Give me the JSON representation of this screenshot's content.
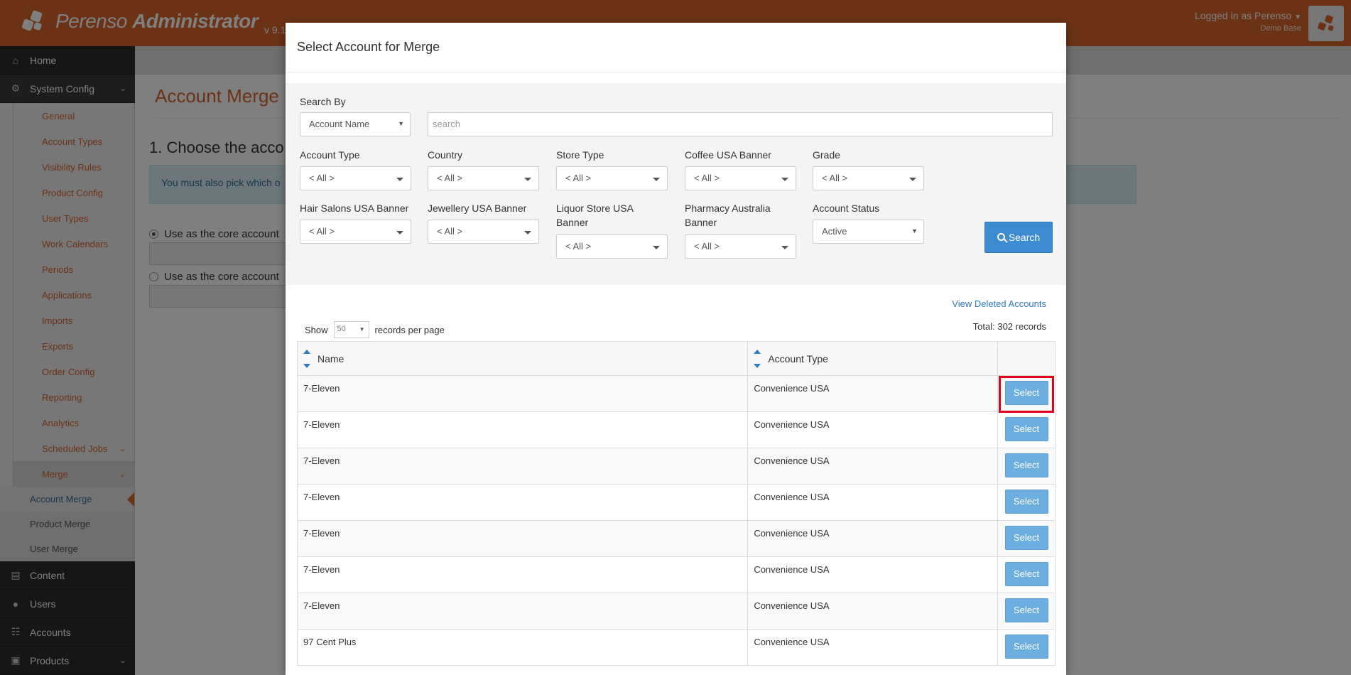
{
  "header": {
    "brand_light": "Perenso",
    "brand_bold": "Administrator",
    "version": "v 9.1",
    "user": "Logged in as Perenso",
    "database": "Demo Base",
    "user_caret": "▼"
  },
  "sidebar": {
    "home": "Home",
    "system_config": "System Config",
    "chevron": "⌄",
    "sub_items": [
      "General",
      "Account Types",
      "Visibility Rules",
      "Product Config",
      "User Types",
      "Work Calendars",
      "Periods",
      "Applications",
      "Imports",
      "Exports",
      "Order Config",
      "Reporting",
      "Analytics",
      "Scheduled Jobs",
      "Merge"
    ],
    "merge_items": [
      "Account Merge",
      "Product Merge",
      "User Merge"
    ],
    "bottom": [
      "Content",
      "Users",
      "Accounts",
      "Products"
    ]
  },
  "page": {
    "title": "Account Merge",
    "step": "1. Choose the acco",
    "alert": "You must also pick which o",
    "radio1": "Use as the core account",
    "radio2": "Use as the core account"
  },
  "modal": {
    "title": "Select Account for Merge",
    "search_by_label": "Search By",
    "search_by_value": "Account Name",
    "search_placeholder": "search",
    "filters": {
      "account_type": {
        "label": "Account Type",
        "value": "< All >"
      },
      "country": {
        "label": "Country",
        "value": "< All >"
      },
      "store_type": {
        "label": "Store Type",
        "value": "< All >"
      },
      "coffee_banner": {
        "label": "Coffee USA Banner",
        "value": "< All >"
      },
      "grade": {
        "label": "Grade",
        "value": "< All >"
      },
      "hair_banner": {
        "label": "Hair Salons USA Banner",
        "value": "< All >"
      },
      "jewellery_banner": {
        "label": "Jewellery USA Banner",
        "value": "< All >"
      },
      "liquor_banner": {
        "label": "Liquor Store USA Banner",
        "value": "< All >"
      },
      "pharmacy_banner": {
        "label": "Pharmacy Australia Banner",
        "value": "< All >"
      },
      "account_status": {
        "label": "Account Status",
        "value": "Active"
      }
    },
    "search_button": "Search",
    "view_deleted": "View Deleted Accounts",
    "show_label": "Show",
    "page_size": "50",
    "per_page_label": "records per page",
    "total": "Total: 302 records",
    "columns": [
      "Name",
      "Account Type",
      ""
    ],
    "select_label": "Select",
    "rows": [
      {
        "name": "7-Eleven",
        "type": "Convenience USA"
      },
      {
        "name": "7-Eleven",
        "type": "Convenience USA"
      },
      {
        "name": "7-Eleven",
        "type": "Convenience USA"
      },
      {
        "name": "7-Eleven",
        "type": "Convenience USA"
      },
      {
        "name": "7-Eleven",
        "type": "Convenience USA"
      },
      {
        "name": "7-Eleven",
        "type": "Convenience USA"
      },
      {
        "name": "7-Eleven",
        "type": "Convenience USA"
      },
      {
        "name": "97 Cent Plus",
        "type": "Convenience USA"
      }
    ]
  },
  "colors": {
    "brand": "#d9642c",
    "primary": "#3d8bd1",
    "highlight": "#e0001b"
  }
}
